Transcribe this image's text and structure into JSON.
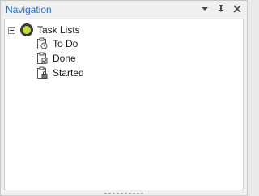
{
  "panel": {
    "title": "Navigation",
    "actions": [
      {
        "name": "dropdown",
        "icon": "chevron-down-icon"
      },
      {
        "name": "pin",
        "icon": "pin-icon"
      },
      {
        "name": "close",
        "icon": "close-icon"
      }
    ]
  },
  "tree": {
    "root": {
      "label": "Task Lists",
      "icon": "task-list-root-icon",
      "expanded": true
    },
    "children": [
      {
        "label": "To Do",
        "icon": "clipboard-clock-icon"
      },
      {
        "label": "Done",
        "icon": "clipboard-check-icon"
      },
      {
        "label": "Started",
        "icon": "clipboard-lock-icon"
      }
    ]
  },
  "colors": {
    "title_text": "#2a6ebd",
    "root_icon_fill": "#c2df3b",
    "background": "#f0f0f0",
    "tree_background": "#ffffff"
  }
}
